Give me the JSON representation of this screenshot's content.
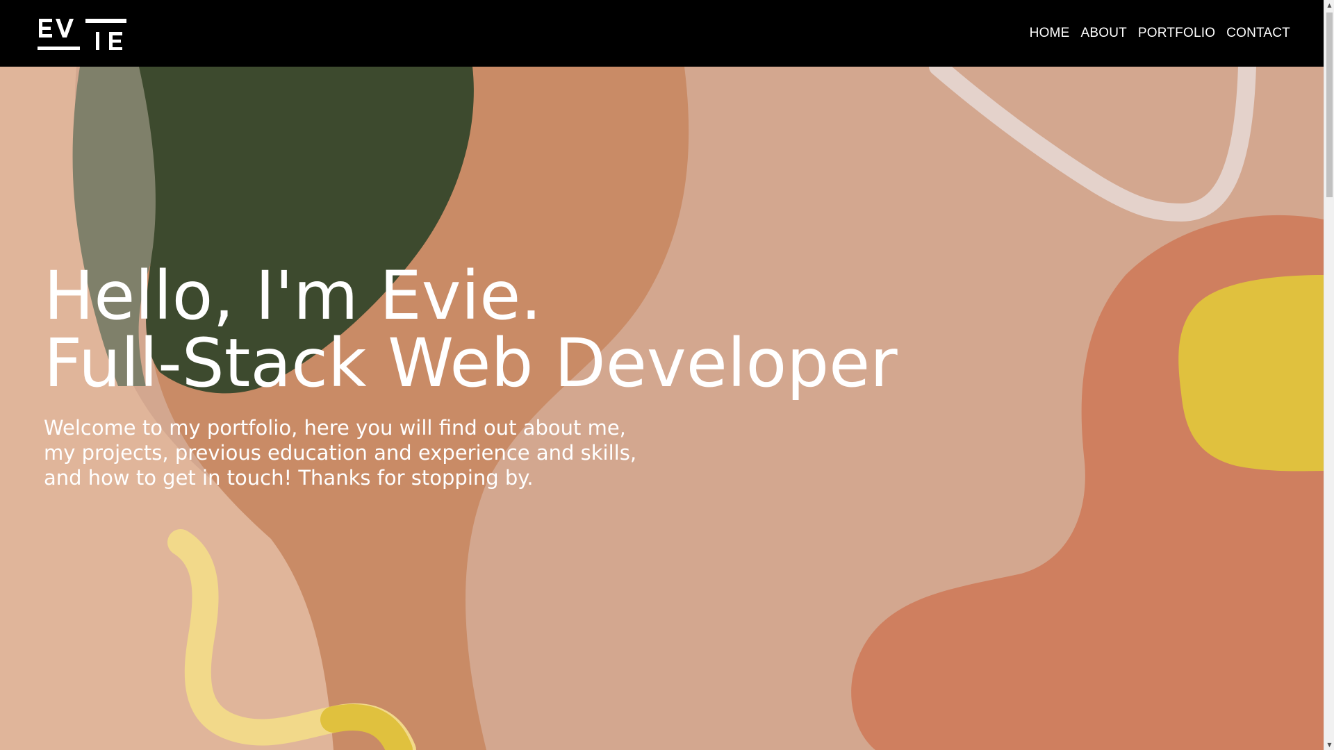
{
  "navbar": {
    "logo_text": "EVIE",
    "links": [
      {
        "label": "HOME"
      },
      {
        "label": "ABOUT"
      },
      {
        "label": "PORTFOLIO"
      },
      {
        "label": "CONTACT"
      }
    ],
    "background": "#000000"
  },
  "hero": {
    "title_line1": "Hello, I'm Evie.",
    "title_line2": "Full-Stack Web Developer",
    "subtitle": "Welcome to my portfolio, here you will find out about me, my projects, previous education and experience and skills, and how to get in touch! Thanks for stopping by.",
    "colors": {
      "peach": "#d3a78f",
      "light_peach": "#e0b59a",
      "terracotta": "#c98b66",
      "dark_green": "#3d4a2e",
      "olive_grey": "#7f806a",
      "coral": "#cf7f5f",
      "mustard": "#e0c13e",
      "pale_yellow": "#f2d98a",
      "pale_line": "#e6d9d6"
    }
  },
  "scrollbar": {
    "up_icon": "chevron-up-icon",
    "down_icon": "chevron-down-icon"
  }
}
